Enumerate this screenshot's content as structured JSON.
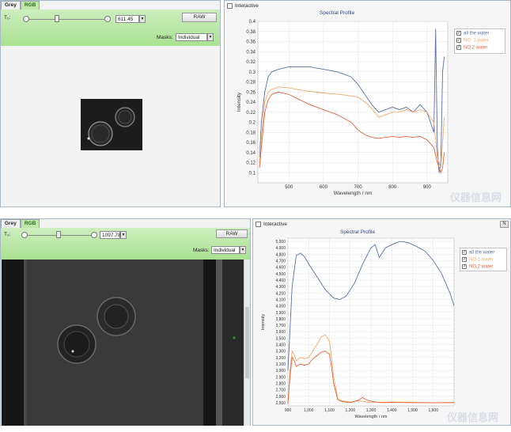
{
  "top": {
    "tabs": [
      "Grey",
      "RGB"
    ],
    "slider_label": "T₀:",
    "slider_value": "611.45",
    "raw_button": "RAW",
    "masks_label": "Masks:",
    "masks_value": "Individual",
    "interactive_label": "Interactive",
    "chart_title": "Spectral Profile",
    "legend": [
      {
        "label": "all the water",
        "color": "#5a6fa8",
        "checked": "✓"
      },
      {
        "label": "NO. 1 water",
        "color": "#f0a868",
        "checked": "✓"
      },
      {
        "label": "NO.2 water",
        "color": "#e2643c",
        "checked": "✓"
      }
    ]
  },
  "bottom": {
    "tabs": [
      "Grey",
      "RGB"
    ],
    "slider_label": "T₀:",
    "slider_value": "1097.78",
    "raw_button": "RAW",
    "masks_label": "Masks:",
    "masks_value": "Individual",
    "interactive_label": "Interactive",
    "chart_title": "Spectral Profile",
    "corner_button": "N",
    "legend": [
      {
        "label": "all the water",
        "color": "#5a6fa8",
        "checked": "✓"
      },
      {
        "label": "NO.1 water",
        "color": "#f0a868",
        "checked": "✓"
      },
      {
        "label": "NO.2 water",
        "color": "#e2643c",
        "checked": "✓"
      }
    ]
  },
  "watermark": "仪器信息网",
  "chart_data": [
    {
      "type": "line",
      "title": "Spectral Profile",
      "xlabel": "Wavelength / nm",
      "ylabel": "Intensity",
      "xlim": [
        410,
        960
      ],
      "ylim": [
        0.08,
        0.4
      ],
      "xticks": [
        500,
        600,
        700,
        800,
        900
      ],
      "yticks": [
        0.1,
        0.12,
        0.14,
        0.16,
        0.18,
        0.2,
        0.22,
        0.24,
        0.26,
        0.28,
        0.3,
        0.32,
        0.34,
        0.36,
        0.38,
        0.4
      ],
      "grid": true,
      "legend_position": "top-right",
      "series": [
        {
          "name": "all the water",
          "color": "#5a6fa8",
          "x": [
            415,
            420,
            430,
            440,
            450,
            470,
            500,
            530,
            560,
            600,
            640,
            680,
            700,
            720,
            740,
            760,
            780,
            800,
            820,
            840,
            860,
            880,
            900,
            910,
            920,
            925,
            930,
            935,
            940,
            945,
            950
          ],
          "y": [
            0.13,
            0.2,
            0.26,
            0.29,
            0.3,
            0.305,
            0.31,
            0.31,
            0.31,
            0.305,
            0.3,
            0.29,
            0.275,
            0.255,
            0.235,
            0.22,
            0.225,
            0.23,
            0.225,
            0.23,
            0.22,
            0.235,
            0.22,
            0.2,
            0.18,
            0.385,
            0.15,
            0.1,
            0.12,
            0.3,
            0.33
          ]
        },
        {
          "name": "NO. 1 water",
          "color": "#f0a868",
          "x": [
            415,
            420,
            430,
            440,
            450,
            470,
            500,
            550,
            600,
            650,
            700,
            730,
            760,
            780,
            800,
            820,
            840,
            860,
            880,
            900,
            920,
            930,
            940,
            945,
            950
          ],
          "y": [
            0.12,
            0.17,
            0.24,
            0.26,
            0.265,
            0.27,
            0.268,
            0.262,
            0.258,
            0.255,
            0.25,
            0.235,
            0.21,
            0.215,
            0.22,
            0.22,
            0.225,
            0.22,
            0.225,
            0.22,
            0.2,
            0.13,
            0.11,
            0.16,
            0.21
          ]
        },
        {
          "name": "NO.2 water",
          "color": "#e2643c",
          "x": [
            415,
            420,
            430,
            440,
            450,
            470,
            500,
            530,
            560,
            600,
            640,
            680,
            700,
            720,
            740,
            760,
            780,
            800,
            820,
            840,
            860,
            880,
            900,
            920,
            930,
            940,
            945,
            950
          ],
          "y": [
            0.11,
            0.15,
            0.22,
            0.245,
            0.255,
            0.26,
            0.255,
            0.245,
            0.235,
            0.225,
            0.215,
            0.2,
            0.185,
            0.175,
            0.17,
            0.168,
            0.17,
            0.172,
            0.17,
            0.172,
            0.17,
            0.172,
            0.165,
            0.15,
            0.12,
            0.1,
            0.11,
            0.14
          ]
        }
      ]
    },
    {
      "type": "line",
      "title": "Spectral Profile",
      "xlabel": "Wavelength / nm",
      "ylabel": "Intensity",
      "xlim": [
        900,
        1700
      ],
      "ylim": [
        2450,
        5050
      ],
      "xticks": [
        900,
        1000,
        1100,
        1200,
        1300,
        1400,
        1500,
        1600
      ],
      "xtick_labels": [
        "900",
        "1,000",
        "1,100",
        "1,200",
        "1,300",
        "1,400",
        "1,500",
        "1,600"
      ],
      "yticks": [
        2500,
        2600,
        2700,
        2800,
        2900,
        3000,
        3100,
        3200,
        3300,
        3400,
        3500,
        3600,
        3700,
        3800,
        3900,
        4000,
        4100,
        4200,
        4300,
        4400,
        4500,
        4600,
        4700,
        4800,
        4900,
        5000
      ],
      "ytick_labels": [
        "2,500",
        "2,600",
        "2,700",
        "2,800",
        "2,900",
        "3,000",
        "3,100",
        "3,200",
        "3,300",
        "3,400",
        "3,500",
        "3,600",
        "3,700",
        "3,800",
        "3,900",
        "4,000",
        "4,100",
        "4,200",
        "4,300",
        "4,400",
        "4,500",
        "4,600",
        "4,700",
        "4,800",
        "4,900",
        "5,000"
      ],
      "grid": true,
      "legend_position": "top-right",
      "series": [
        {
          "name": "all the water",
          "color": "#5a6fa8",
          "x": [
            900,
            920,
            940,
            960,
            980,
            1000,
            1040,
            1080,
            1120,
            1150,
            1180,
            1220,
            1260,
            1300,
            1320,
            1340,
            1350,
            1370,
            1400,
            1440,
            1480,
            1520,
            1560,
            1600,
            1640,
            1680,
            1700
          ],
          "y": [
            3000,
            4300,
            4780,
            4820,
            4760,
            4650,
            4450,
            4250,
            4120,
            4100,
            4150,
            4350,
            4650,
            4900,
            4950,
            4750,
            4800,
            4900,
            4950,
            5000,
            4980,
            4920,
            4850,
            4700,
            4500,
            4200,
            4000
          ]
        },
        {
          "name": "NO.1 water",
          "color": "#f0a868",
          "x": [
            900,
            910,
            920,
            930,
            940,
            960,
            980,
            1000,
            1020,
            1040,
            1060,
            1080,
            1100,
            1110,
            1120,
            1140,
            1160,
            1200,
            1240,
            1280,
            1320,
            1360,
            1400,
            1500,
            1600,
            1700
          ],
          "y": [
            2500,
            3000,
            3300,
            3250,
            3150,
            3200,
            3180,
            3200,
            3300,
            3400,
            3520,
            3550,
            3450,
            3200,
            2900,
            2560,
            2530,
            2510,
            2530,
            2510,
            2505,
            2505,
            2510,
            2505,
            2500,
            2505
          ]
        },
        {
          "name": "NO.2 water",
          "color": "#e2643c",
          "x": [
            900,
            910,
            920,
            930,
            940,
            960,
            980,
            1000,
            1020,
            1040,
            1060,
            1080,
            1100,
            1110,
            1120,
            1140,
            1160,
            1200,
            1240,
            1260,
            1280,
            1320,
            1360,
            1400,
            1500,
            1600,
            1700
          ],
          "y": [
            2480,
            2900,
            3200,
            3150,
            3060,
            3100,
            3080,
            3100,
            3180,
            3230,
            3280,
            3300,
            3250,
            3050,
            2800,
            2540,
            2520,
            2500,
            2540,
            2580,
            2540,
            2510,
            2500,
            2505,
            2500,
            2500,
            2500
          ]
        }
      ]
    }
  ]
}
